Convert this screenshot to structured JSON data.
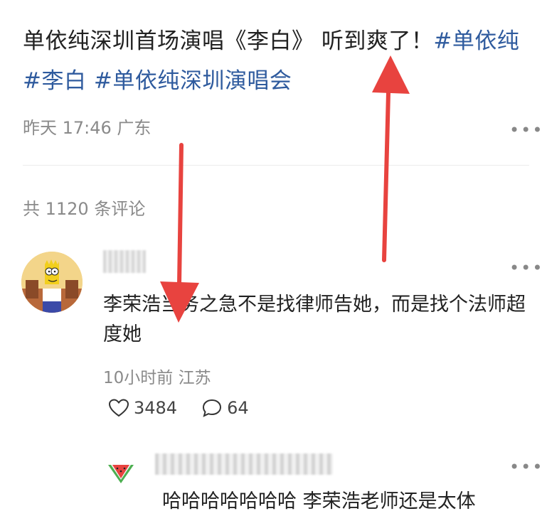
{
  "post": {
    "title_text": "单依纯深圳首场演唱《李白》 听到爽了！",
    "hashtag_1": "#单依纯",
    "hashtag_2": "#李白",
    "hashtag_3": "#单依纯深圳演唱会",
    "meta": "昨天 17:46 广东"
  },
  "comments_header": "共 1120 条评论",
  "comment": {
    "text": "李荣浩当务之急不是找律师告她，而是找个法师超度她",
    "meta": "10小时前 江苏",
    "likes": "3484",
    "replies": "64"
  },
  "reply": {
    "text": "哈哈哈哈哈哈哈 李荣浩老师还是太体"
  },
  "icons": {
    "more": "more-dots-icon",
    "like": "heart-icon",
    "comment": "comment-bubble-icon",
    "watermelon": "watermelon-avatar-icon"
  },
  "colors": {
    "hashtag": "#2f5b9e",
    "meta": "#8a8a8a",
    "arrow": "#e8433f"
  }
}
